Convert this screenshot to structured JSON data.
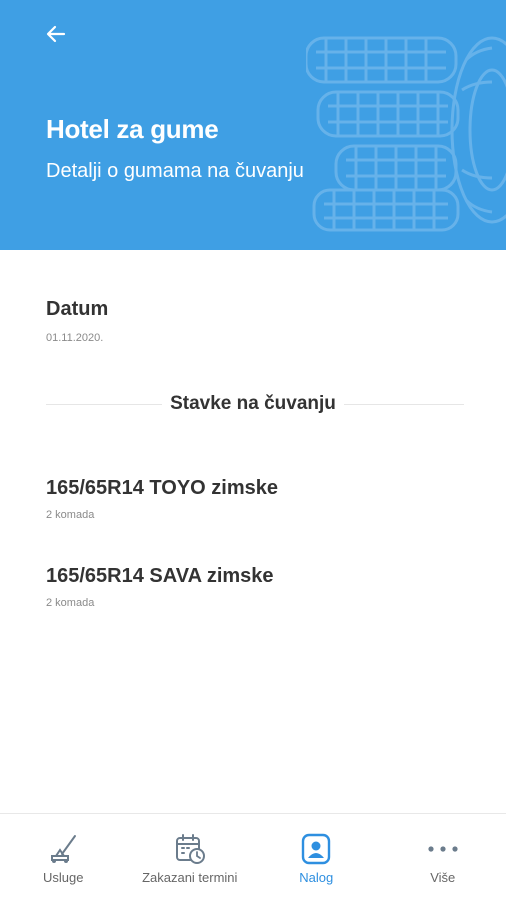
{
  "header": {
    "title": "Hotel za gume",
    "subtitle": "Detalji o gumama na čuvanju",
    "back_icon": "arrow-left-icon",
    "color": "#3f9fe4"
  },
  "details": {
    "date_label": "Datum",
    "date_value": "01.11.2020."
  },
  "section": {
    "title": "Stavke na čuvanju"
  },
  "items": [
    {
      "name": "165/65R14 TOYO zimske",
      "quantity": "2 komada"
    },
    {
      "name": "165/65R14 SAVA zimske",
      "quantity": "2 komada"
    }
  ],
  "bottom_nav": {
    "active_color": "#2e8fe0",
    "items": [
      {
        "label": "Usluge",
        "icon": "jack-icon"
      },
      {
        "label": "Zakazani termini",
        "icon": "calendar-clock-icon"
      },
      {
        "label": "Nalog",
        "icon": "account-icon",
        "active": true
      },
      {
        "label": "Više",
        "icon": "more-dots-icon"
      }
    ]
  }
}
